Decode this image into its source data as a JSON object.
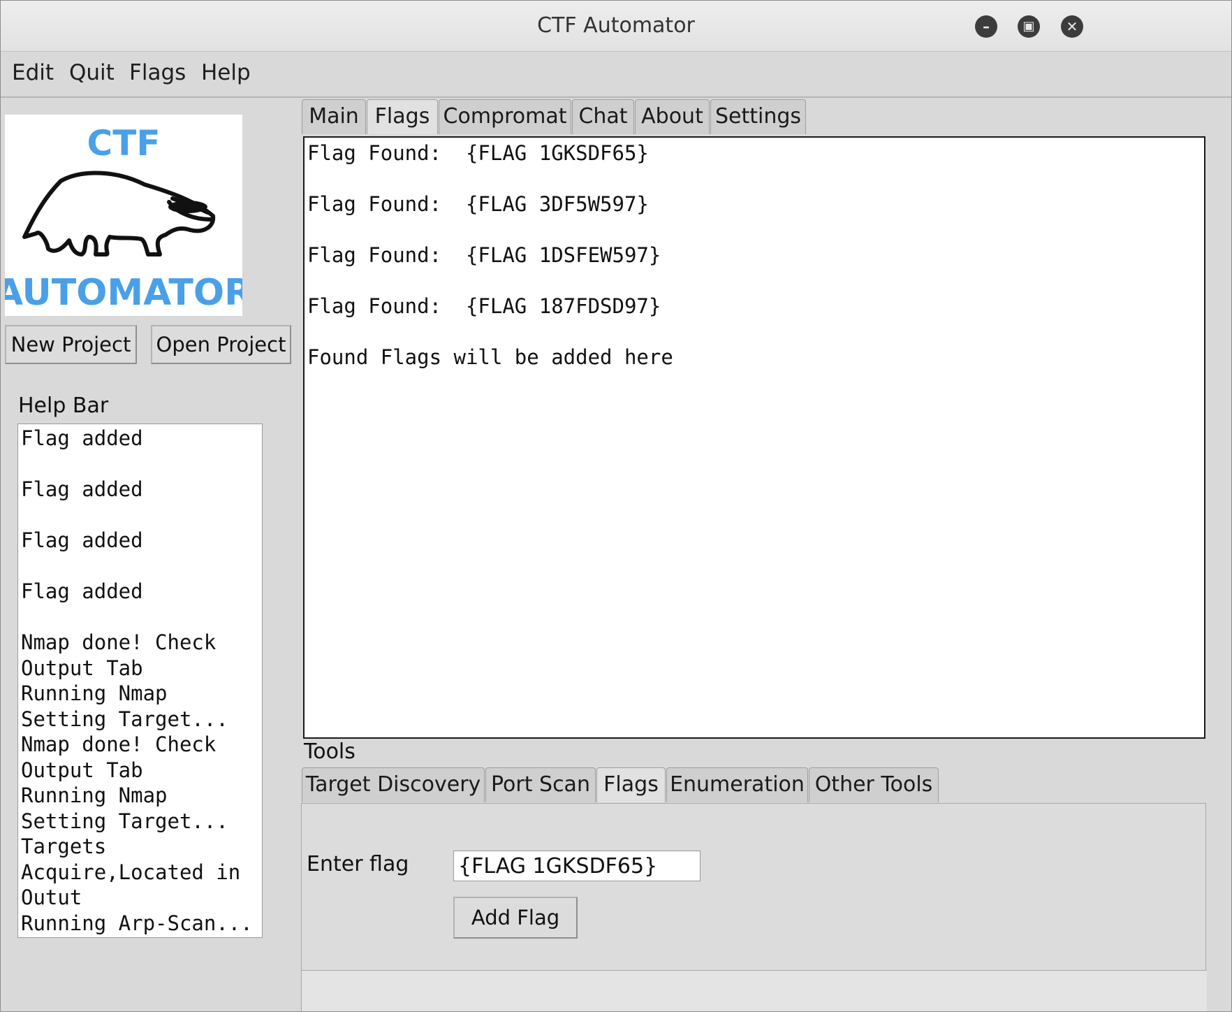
{
  "window": {
    "title": "CTF Automator",
    "controls": {
      "minimize": "minimize-icon",
      "maximize": "maximize-icon",
      "close": "close-icon"
    }
  },
  "menubar": {
    "items": [
      "Edit",
      "Quit",
      "Flags",
      "Help"
    ]
  },
  "logo": {
    "top_text": "CTF",
    "bottom_text": "AUTOMATOR",
    "text_color": "#4aa0e8"
  },
  "project_buttons": {
    "new": "New Project",
    "open": "Open Project"
  },
  "help_bar": {
    "label": "Help Bar",
    "lines": [
      "Flag added",
      "",
      "Flag added",
      "",
      "Flag added",
      "",
      "Flag added",
      "",
      "Nmap done! Check",
      "Output Tab",
      "Running Nmap",
      "Setting Target...",
      "Nmap done! Check",
      "Output Tab",
      "Running Nmap",
      "Setting Target...",
      "Targets",
      "Acquire,Located in",
      "Outut",
      "Running Arp-Scan..."
    ]
  },
  "main_tabs": {
    "items": [
      "Main",
      "Flags",
      "Compromat",
      "Chat",
      "About",
      "Settings"
    ],
    "active": "Flags"
  },
  "output": {
    "lines": [
      "Flag Found:  {FLAG 1GKSDF65}",
      "",
      "Flag Found:  {FLAG 3DF5W597}",
      "",
      "Flag Found:  {FLAG 1DSFEW597}",
      "",
      "Flag Found:  {FLAG 187FDSD97}",
      "",
      "Found Flags will be added here"
    ]
  },
  "tools": {
    "label": "Tools",
    "tabs": [
      "Target Discovery",
      "Port Scan",
      "Flags",
      "Enumeration",
      "Other Tools"
    ],
    "active": "Flags",
    "flags_panel": {
      "enter_label": "Enter flag",
      "input_value": "{FLAG 1GKSDF65}",
      "add_button": "Add Flag"
    }
  }
}
